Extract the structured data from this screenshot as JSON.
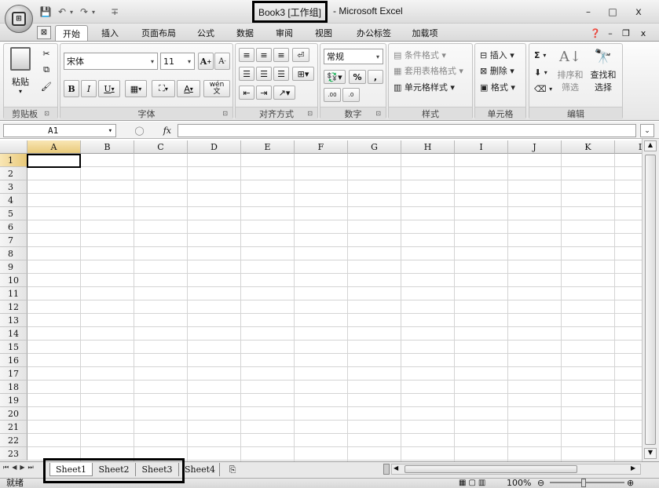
{
  "window": {
    "title_highlight": "Book3 [工作组]",
    "title_rest": "- Microsoft Excel",
    "office_button_glyph": "⊞",
    "qat": {
      "save": "💾",
      "undo": "↶",
      "undo_arrow": "▾",
      "redo": "↷",
      "redo_arrow": "▾",
      "customize": "∓"
    },
    "controls": {
      "minimize": "–",
      "maximize": "□",
      "close": "x"
    },
    "workbook_controls": {
      "help": "❓",
      "minimize": "–",
      "restore": "❐",
      "close": "x"
    }
  },
  "ribbon_tabs": [
    "开始",
    "插入",
    "页面布局",
    "公式",
    "数据",
    "审阅",
    "视图",
    "办公标签",
    "加载项"
  ],
  "ribbon": {
    "clipboard": {
      "paste": "粘贴",
      "label": "剪贴板"
    },
    "font": {
      "name": "宋体",
      "size": "11",
      "bold": "B",
      "italic": "I",
      "underline": "U",
      "grow": "A",
      "shrink": "A",
      "phonetic": "wén",
      "label": "字体"
    },
    "alignment": {
      "label": "对齐方式"
    },
    "number": {
      "format": "常规",
      "percent": "%",
      "comma": ",",
      "inc_decimal": ".00",
      "dec_decimal": ".0",
      "label": "数字"
    },
    "styles": {
      "conditional": "条件格式",
      "table": "套用表格格式",
      "cell": "单元格样式",
      "label": "样式"
    },
    "cells": {
      "insert": "插入",
      "delete": "删除",
      "format": "格式",
      "label": "单元格"
    },
    "editing": {
      "sum": "Σ",
      "sort": "排序和",
      "sort2": "筛选",
      "find": "查找和",
      "find2": "选择",
      "label": "编辑"
    }
  },
  "formula_bar": {
    "name_box": "A1",
    "fx": "fx",
    "value": ""
  },
  "grid": {
    "columns": [
      "A",
      "B",
      "C",
      "D",
      "E",
      "F",
      "G",
      "H",
      "I",
      "J",
      "K",
      "L"
    ],
    "rows": [
      "1",
      "2",
      "3",
      "4",
      "5",
      "6",
      "7",
      "8",
      "9",
      "10",
      "11",
      "12",
      "13",
      "14",
      "15",
      "16",
      "17",
      "18",
      "19",
      "20",
      "21",
      "22",
      "23"
    ],
    "active_cell": "A1"
  },
  "sheets": [
    "Sheet1",
    "Sheet2",
    "Sheet3",
    "Sheet4"
  ],
  "status": {
    "ready": "就绪",
    "zoom": "100%"
  }
}
